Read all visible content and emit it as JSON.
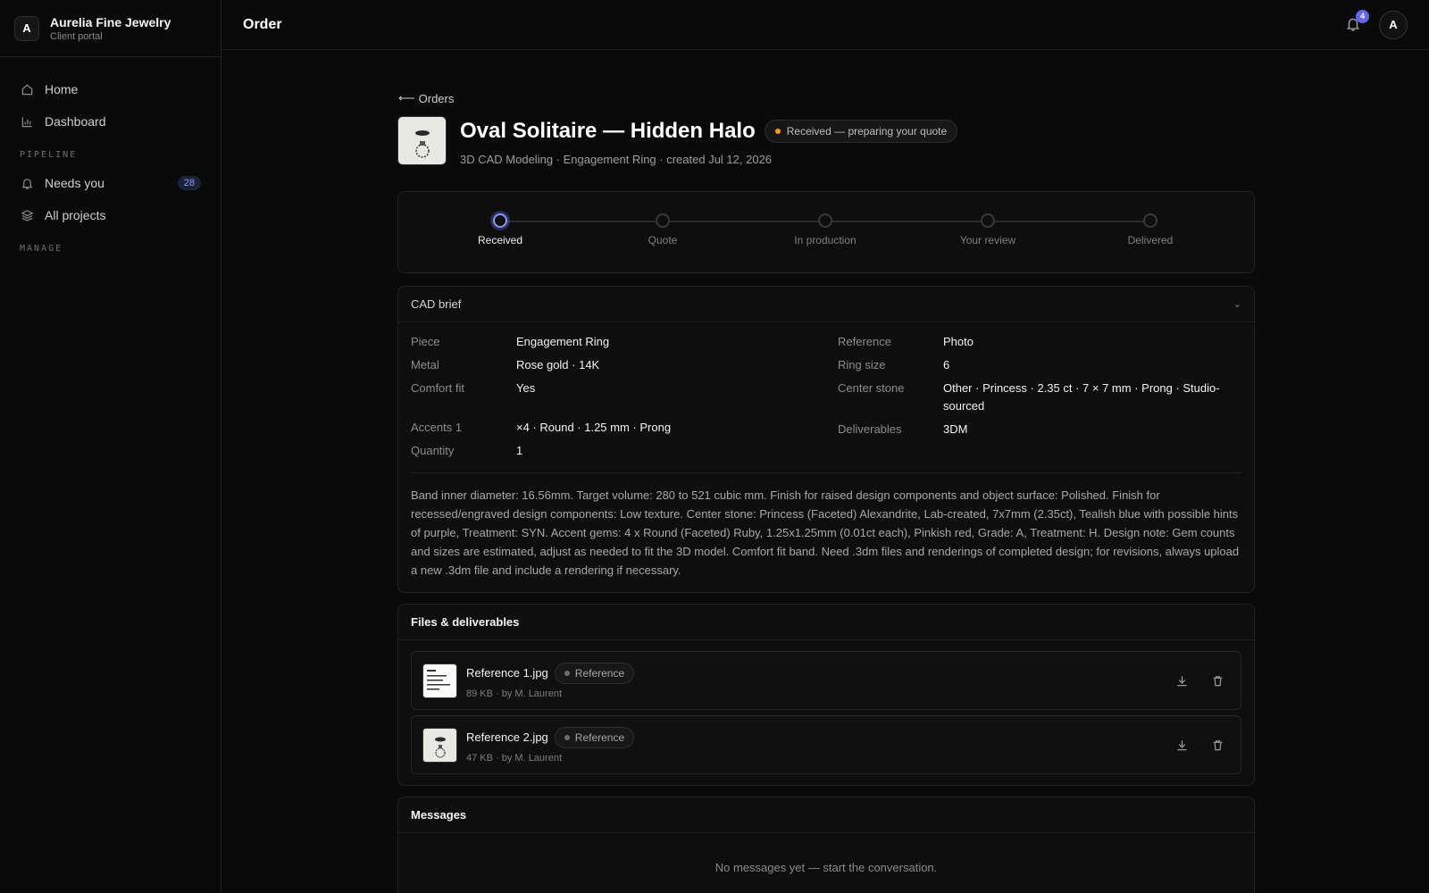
{
  "brand": {
    "initial": "A",
    "name": "Aurelia Fine Jewelry",
    "subtitle": "Client portal"
  },
  "nav": {
    "home": "Home",
    "dashboard": "Dashboard",
    "section_pipeline": "PIPELINE",
    "needs_you": "Needs you",
    "needs_you_count": "28",
    "all_projects": "All projects",
    "section_manage": "MANAGE"
  },
  "topbar": {
    "title": "Order",
    "notification_count": "4",
    "avatar_initial": "A"
  },
  "back_label": "Orders",
  "order": {
    "title": "Oval Solitaire — Hidden Halo",
    "status": "Received — preparing your quote",
    "subtitle": "3D CAD Modeling · Engagement Ring · created Jul 12, 2026"
  },
  "steps": [
    {
      "label": "Received",
      "active": true
    },
    {
      "label": "Quote",
      "active": false
    },
    {
      "label": "In production",
      "active": false
    },
    {
      "label": "Your review",
      "active": false
    },
    {
      "label": "Delivered",
      "active": false
    }
  ],
  "brief": {
    "title": "CAD brief",
    "left": [
      {
        "k": "Piece",
        "v": "Engagement Ring"
      },
      {
        "k": "Metal",
        "v": "Rose gold · 14K"
      },
      {
        "k": "Comfort fit",
        "v": "Yes"
      },
      {
        "k": "Accents 1",
        "v": "×4 · Round · 1.25 mm · Prong"
      },
      {
        "k": "Quantity",
        "v": "1"
      }
    ],
    "right": [
      {
        "k": "Reference",
        "v": "Photo"
      },
      {
        "k": "Ring size",
        "v": "6"
      },
      {
        "k": "Center stone",
        "v": "Other · Princess · 2.35 ct · 7 × 7 mm · Prong · Studio-sourced"
      },
      {
        "k": "Deliverables",
        "v": "3DM"
      }
    ],
    "notes": "Band inner diameter: 16.56mm. Target volume: 280 to 521 cubic mm. Finish for raised design components and object surface: Polished. Finish for recessed/engraved design components: Low texture. Center stone: Princess (Faceted) Alexandrite, Lab-created, 7x7mm (2.35ct), Tealish blue with possible hints of purple, Treatment: SYN. Accent gems: 4 x Round (Faceted) Ruby, 1.25x1.25mm (0.01ct each), Pinkish red, Grade: A, Treatment: H. Design note: Gem counts and sizes are estimated, adjust as needed to fit the 3D model. Comfort fit band. Need .3dm files and renderings of completed design; for revisions, always upload a new .3dm file and include a rendering if necessary."
  },
  "files": {
    "title": "Files & deliverables",
    "items": [
      {
        "name": "Reference 1.jpg",
        "tag": "Reference",
        "meta": "89 KB · by M. Laurent"
      },
      {
        "name": "Reference 2.jpg",
        "tag": "Reference",
        "meta": "47 KB · by M. Laurent"
      }
    ]
  },
  "messages": {
    "title": "Messages",
    "empty": "No messages yet — start the conversation."
  },
  "colors": {
    "accent": "#6366f1",
    "status_amber": "#f59e0b",
    "background": "#0a0a0a"
  }
}
